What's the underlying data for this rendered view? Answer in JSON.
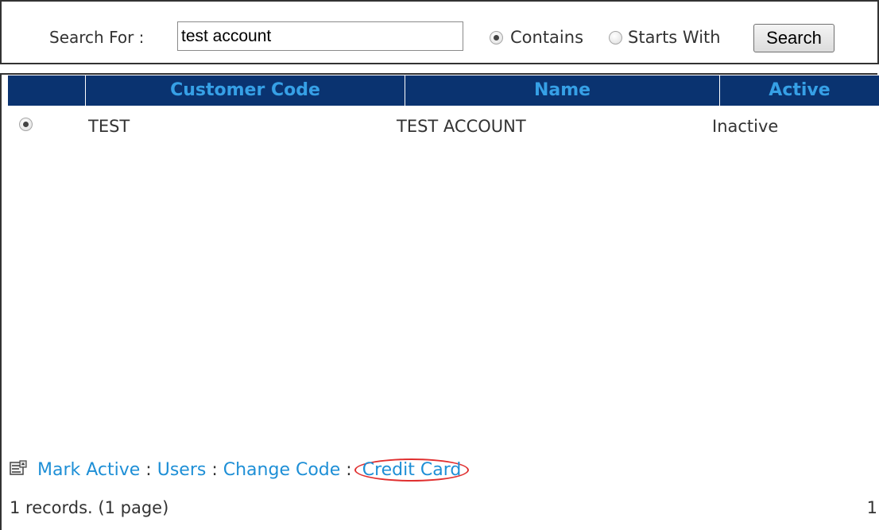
{
  "search": {
    "label": "Search For :",
    "value": "test account",
    "options": [
      {
        "label": "Contains",
        "checked": true
      },
      {
        "label": "Starts With",
        "checked": false
      }
    ],
    "button_label": "Search"
  },
  "grid": {
    "columns": [
      "Customer Code",
      "Name",
      "Active"
    ],
    "rows": [
      {
        "selected": true,
        "code": "TEST",
        "name": "TEST ACCOUNT",
        "active": "Inactive"
      }
    ]
  },
  "actions": {
    "icon": "properties-icon",
    "items": [
      "Mark Active",
      "Users",
      "Change Code",
      "Credit Card"
    ],
    "separator": ":",
    "highlighted_item": "Credit Card",
    "highlight_color": "#e03030",
    "link_color": "#1e8fd6"
  },
  "footer": {
    "status": "1 records. (1 page)",
    "page": "1"
  },
  "colors": {
    "header_bg": "#0a3370",
    "header_text": "#36a0e6"
  }
}
